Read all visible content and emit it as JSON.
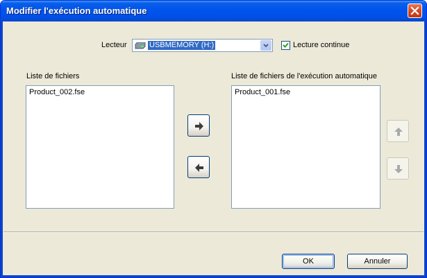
{
  "window": {
    "title": "Modifier l'exécution automatique"
  },
  "drive": {
    "label": "Lecteur",
    "selected": "USBMEMORY (H:)",
    "icon": "drive-icon"
  },
  "continuous": {
    "label": "Lecture continue",
    "checked": true
  },
  "files": {
    "title": "Liste de fichiers",
    "items": [
      "Product_002.fse"
    ]
  },
  "autorun": {
    "title": "Liste de fichiers de l'exécution automatique",
    "items": [
      "Product_001.fse"
    ]
  },
  "buttons": {
    "ok": "OK",
    "cancel": "Annuler"
  },
  "colors": {
    "titlebar": "#0053ee",
    "dialog": "#ece9d8",
    "selection": "#316ac5",
    "close": "#d44a22"
  }
}
